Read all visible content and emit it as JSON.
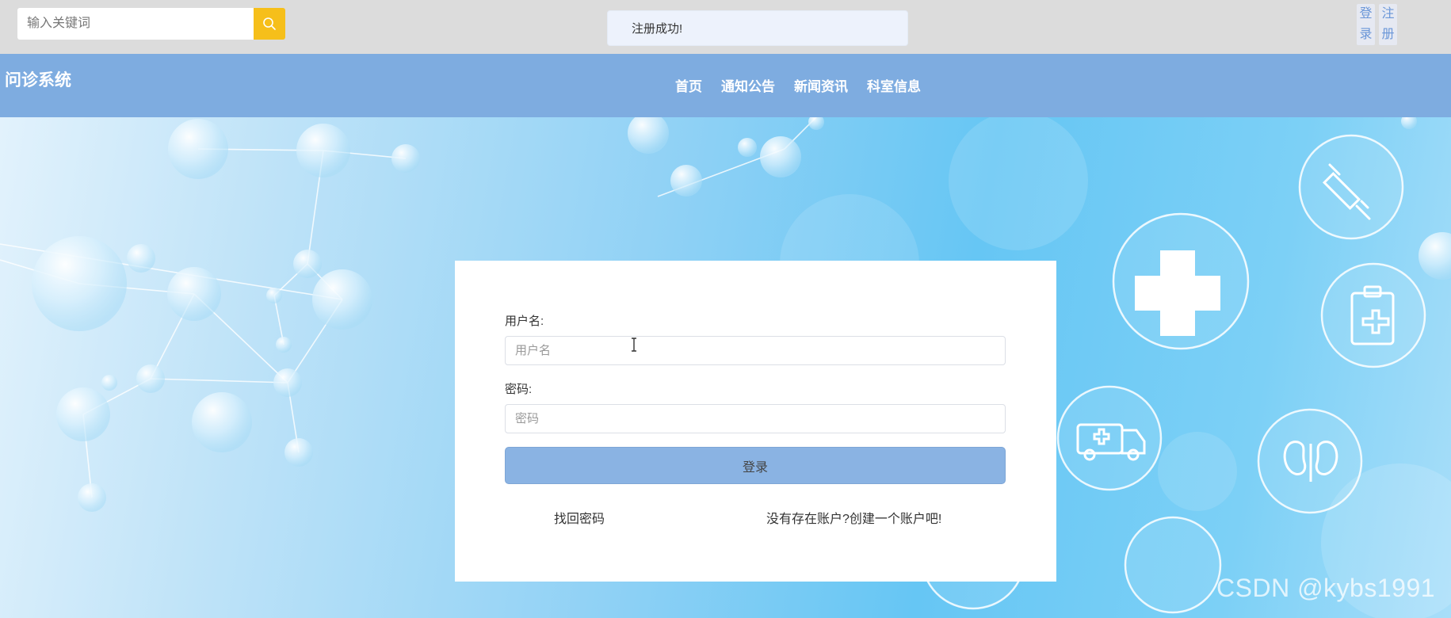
{
  "search": {
    "placeholder": "输入关键词",
    "button_icon": "search-icon"
  },
  "toast": {
    "message": "注册成功!"
  },
  "auth": {
    "login_label": "登录",
    "register_label": "注册"
  },
  "site": {
    "title": "问诊系统"
  },
  "nav": {
    "items": [
      {
        "label": "首页"
      },
      {
        "label": "通知公告"
      },
      {
        "label": "新闻资讯"
      },
      {
        "label": "科室信息"
      }
    ]
  },
  "login_form": {
    "username_label": "用户名:",
    "username_placeholder": "用户名",
    "password_label": "密码:",
    "password_placeholder": "密码",
    "submit_label": "登录",
    "forgot_link": "找回密码",
    "register_link": "没有存在账户?创建一个账户吧!"
  },
  "watermark": "CSDN @kybs1991",
  "colors": {
    "nav_bg": "#7eace0",
    "search_button": "#f6bf1a",
    "login_button": "#8ab3e3",
    "topbar_bg": "#dcdcdc"
  }
}
